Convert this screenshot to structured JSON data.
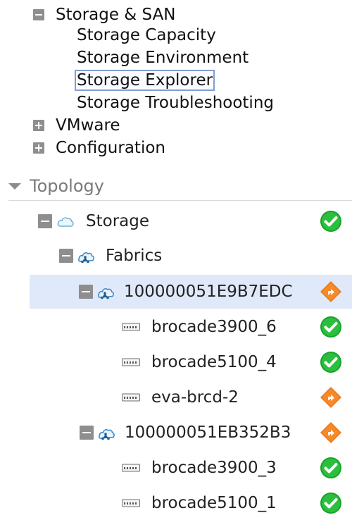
{
  "nav": {
    "storage_san": {
      "label": "Storage & SAN",
      "expanded": true,
      "icon": "minus-box-icon",
      "children": [
        "Storage Capacity",
        "Storage Environment",
        "Storage Explorer",
        "Storage Troubleshooting"
      ],
      "selected": "Storage Explorer"
    },
    "vmware": {
      "label": "VMware",
      "expanded": false,
      "icon": "plus-box-icon"
    },
    "configuration": {
      "label": "Configuration",
      "expanded": false,
      "icon": "plus-box-icon"
    }
  },
  "topology": {
    "title": "Topology",
    "storage": {
      "label": "Storage",
      "status": "ok",
      "icon": "cloud-icon"
    },
    "fabrics": {
      "label": "Fabrics",
      "icon": "fabric-icon"
    },
    "fabric_a": {
      "label": "100000051E9B7EDC",
      "status": "warning",
      "highlighted": true,
      "switches": [
        {
          "label": "brocade3900_6",
          "status": "ok"
        },
        {
          "label": "brocade5100_4",
          "status": "ok"
        },
        {
          "label": "eva-brcd-2",
          "status": "warning"
        }
      ]
    },
    "fabric_b": {
      "label": "100000051EB352B3",
      "status": "warning",
      "switches": [
        {
          "label": "brocade3900_3",
          "status": "ok"
        },
        {
          "label": "brocade5100_1",
          "status": "ok"
        }
      ]
    }
  },
  "colors": {
    "ok": "#1aa52a",
    "warning": "#f07a1c",
    "selection_border": "#7f9fcf",
    "row_highlight": "#dfe9f9"
  }
}
